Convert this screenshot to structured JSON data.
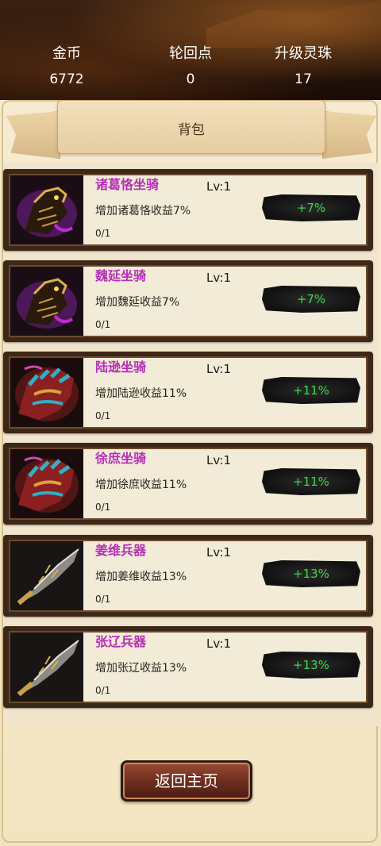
{
  "header": {
    "stats": [
      {
        "label": "金币",
        "value": "6772"
      },
      {
        "label": "轮回点",
        "value": "0"
      },
      {
        "label": "升级灵珠",
        "value": "17"
      }
    ]
  },
  "panel": {
    "title": "背包"
  },
  "items": [
    {
      "name": "诸葛恪坐骑",
      "level": "Lv:1",
      "desc": "增加诸葛恪收益7%",
      "count": "0/1",
      "bonus": "+7%",
      "icon": "horse-purple-icon"
    },
    {
      "name": "魏延坐骑",
      "level": "Lv:1",
      "desc": "增加魏延收益7%",
      "count": "0/1",
      "bonus": "+7%",
      "icon": "horse-purple-icon"
    },
    {
      "name": "陆逊坐骑",
      "level": "Lv:1",
      "desc": "增加陆逊收益11%",
      "count": "0/1",
      "bonus": "+11%",
      "icon": "horse-armored-icon"
    },
    {
      "name": "徐庶坐骑",
      "level": "Lv:1",
      "desc": "增加徐庶收益11%",
      "count": "0/1",
      "bonus": "+11%",
      "icon": "horse-armored-icon"
    },
    {
      "name": "姜维兵器",
      "level": "Lv:1",
      "desc": "增加姜维收益13%",
      "count": "0/1",
      "bonus": "+13%",
      "icon": "blade-icon"
    },
    {
      "name": "张辽兵器",
      "level": "Lv:1",
      "desc": "增加张辽收益13%",
      "count": "0/1",
      "bonus": "+13%",
      "icon": "blade-icon"
    }
  ],
  "footer": {
    "return_label": "返回主页"
  },
  "colors": {
    "item_name": "#b62fb8",
    "bonus_text": "#3fd64a",
    "button_bg": "#6b2c1d"
  }
}
